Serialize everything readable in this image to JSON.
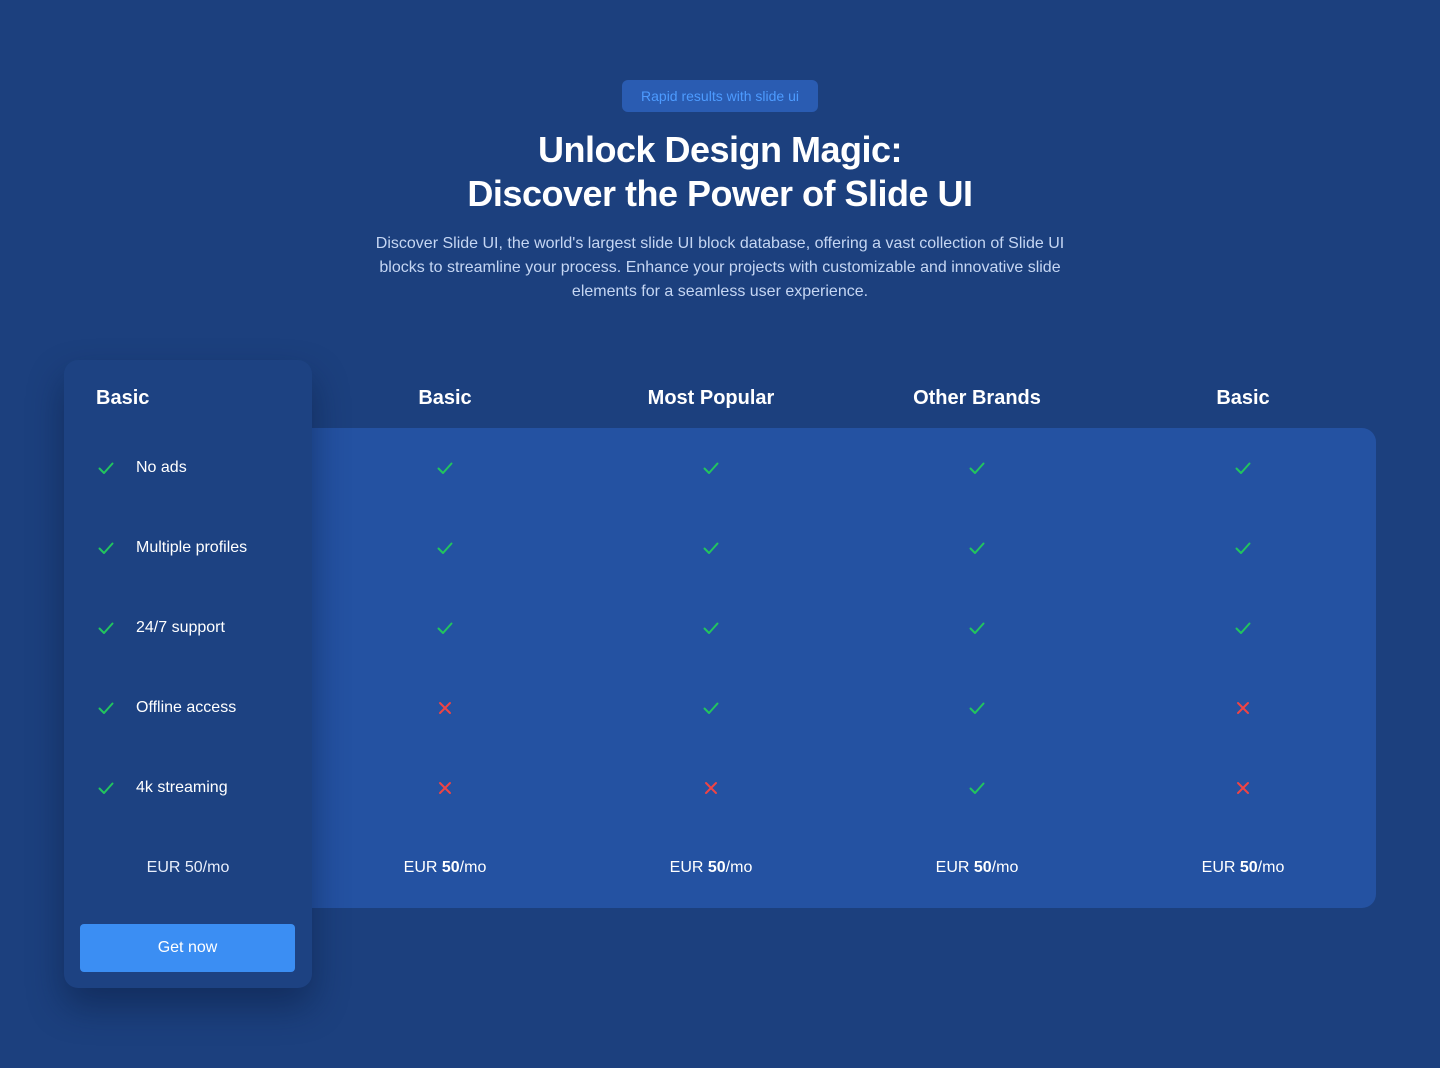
{
  "header": {
    "badge": "Rapid results with slide ui",
    "title_line1": "Unlock Design Magic:",
    "title_line2": "Discover the Power of Slide UI",
    "description": "Discover Slide UI, the world's largest slide UI block database, offering a vast collection of Slide UI blocks to streamline your process. Enhance your projects with customizable and innovative slide elements for a seamless user experience."
  },
  "plan": {
    "title": "Basic",
    "features": [
      {
        "label": "No ads",
        "icon": "check-icon"
      },
      {
        "label": "Multiple profiles",
        "icon": "check-icon"
      },
      {
        "label": "24/7 support",
        "icon": "check-icon"
      },
      {
        "label": "Offline access",
        "icon": "check-icon"
      },
      {
        "label": "4k streaming",
        "icon": "check-icon"
      }
    ],
    "price": "EUR 50/mo",
    "cta": "Get now"
  },
  "columns": [
    {
      "name": "Basic",
      "values": [
        true,
        true,
        true,
        false,
        false
      ],
      "price_prefix": "EUR ",
      "price_amount": "50",
      "price_suffix": "/mo"
    },
    {
      "name": "Most Popular",
      "values": [
        true,
        true,
        true,
        true,
        false
      ],
      "price_prefix": "EUR ",
      "price_amount": "50",
      "price_suffix": "/mo"
    },
    {
      "name": "Other Brands",
      "values": [
        true,
        true,
        true,
        true,
        true
      ],
      "price_prefix": "EUR ",
      "price_amount": "50",
      "price_suffix": "/mo"
    },
    {
      "name": "Basic",
      "values": [
        true,
        true,
        true,
        false,
        false
      ],
      "price_prefix": "EUR ",
      "price_amount": "50",
      "price_suffix": "/mo"
    }
  ],
  "colors": {
    "background": "#1c407e",
    "panel": "#2452a2",
    "card": "#1d4282",
    "check": "#22c55e",
    "cross": "#ef4444",
    "button": "#3b8ef3",
    "badge_bg": "#2a5cb2",
    "badge_text": "#4d9bff"
  }
}
